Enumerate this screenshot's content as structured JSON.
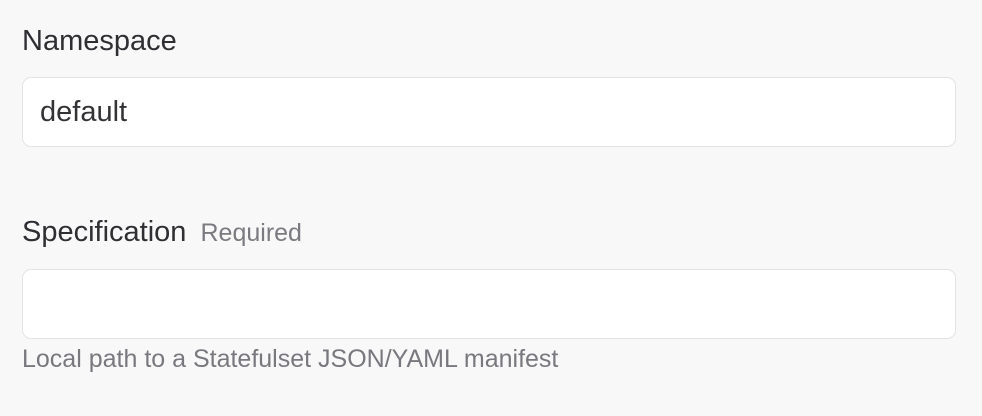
{
  "form": {
    "namespace": {
      "label": "Namespace",
      "value": "default",
      "placeholder": ""
    },
    "specification": {
      "label": "Specification",
      "required_hint": "Required",
      "value": "",
      "placeholder": "",
      "help_text": "Local path to a Statefulset JSON/YAML manifest"
    }
  },
  "colors": {
    "background": "#f8f8f9",
    "input_background": "#ffffff",
    "input_border": "#e3e3e6",
    "label_text": "#2f2f33",
    "hint_text": "#7a7a80"
  }
}
